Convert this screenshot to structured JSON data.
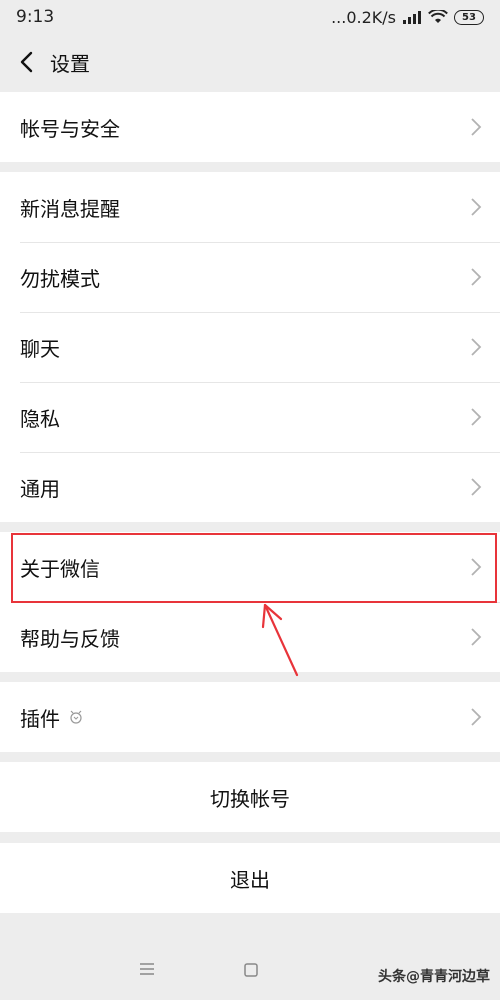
{
  "status_bar": {
    "time": "9:13",
    "speed": "...0.2K/s",
    "battery": "53"
  },
  "header": {
    "title": "设置"
  },
  "groups": {
    "account": [
      {
        "label": "帐号与安全"
      }
    ],
    "general": [
      {
        "label": "新消息提醒"
      },
      {
        "label": "勿扰模式"
      },
      {
        "label": "聊天"
      },
      {
        "label": "隐私"
      },
      {
        "label": "通用"
      }
    ],
    "about": [
      {
        "label": "关于微信"
      },
      {
        "label": "帮助与反馈"
      }
    ],
    "plugins": [
      {
        "label": "插件",
        "icon": "plugin-icon"
      }
    ]
  },
  "actions": {
    "switch_account": "切换帐号",
    "logout": "退出"
  },
  "watermark": "头条@青青河边草",
  "colors": {
    "highlight": "#e8343a",
    "background": "#ededed"
  }
}
